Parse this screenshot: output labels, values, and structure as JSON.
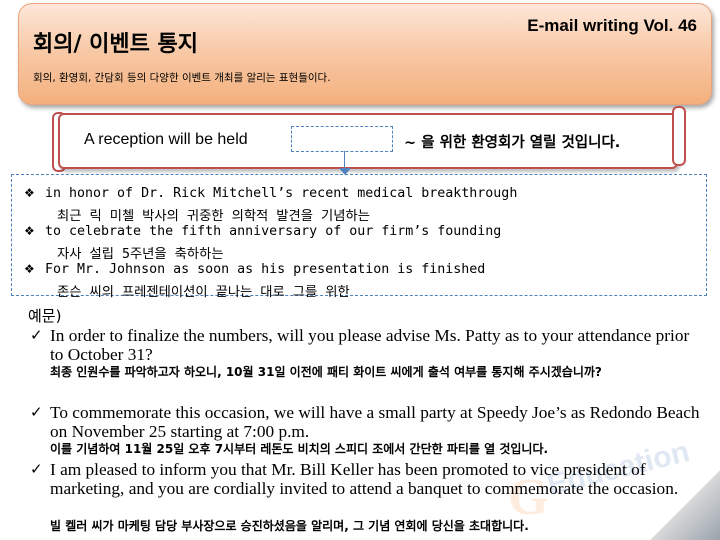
{
  "header": {
    "series": "E-mail writing Vol. 46",
    "title": "회의/ 이벤트 통지",
    "subtitle": "회의, 환영회, 간담회 등의 다양한 이벤트 개최를 알리는 표현들이다."
  },
  "pattern": {
    "english": "A reception will be held",
    "korean": "~ 을 위한 환영회가 열릴 것입니다."
  },
  "options": [
    {
      "bullet": "❖",
      "en": "in honor of Dr. Rick Mitchell’s recent medical breakthrough",
      "ko": "최근 릭 미첼 박사의 귀중한 의학적 발견을 기념하는"
    },
    {
      "bullet": "❖",
      "en": "to celebrate the fifth anniversary of our firm’s founding",
      "ko": "자사 설립 5주년을 축하하는"
    },
    {
      "bullet": "❖",
      "en": "For Mr. Johnson as soon as his presentation is finished",
      "ko": "존슨 씨의 프레젠테이션이 끝나는 대로 그를 위한"
    }
  ],
  "examples_label": "예문)",
  "examples": [
    {
      "check": "✓",
      "en": "In order to finalize the numbers, will you please advise Ms. Patty as to your attendance prior to October 31?",
      "ko": "최종 인원수를 파악하고자 하오니, 10월 31일 이전에 패티 화이트 씨에게 출석 여부를 통지해 주시겠습니까?"
    },
    {
      "check": "✓",
      "en": "To commemorate this occasion, we will have a small party at Speedy Joe’s as Redondo Beach on November 25 starting at 7:00 p.m.",
      "ko": "이를 기념하여 11월 25일 오후 7시부터 레돈도 비치의 스피디 조에서 간단한 파티를 열 것입니다."
    },
    {
      "check": "✓",
      "en": "I am pleased to inform you that Mr. Bill Keller has been promoted to vice president of marketing, and you are cordially invited to attend a banquet to commemorate the occasion.",
      "ko": "빌 켈러 씨가 마케팅 담당 부사장으로 승진하셨음을 알리며, 그 기념 연회에 당신을 초대합니다."
    }
  ],
  "watermark": {
    "letter": "G",
    "text": "Education"
  }
}
